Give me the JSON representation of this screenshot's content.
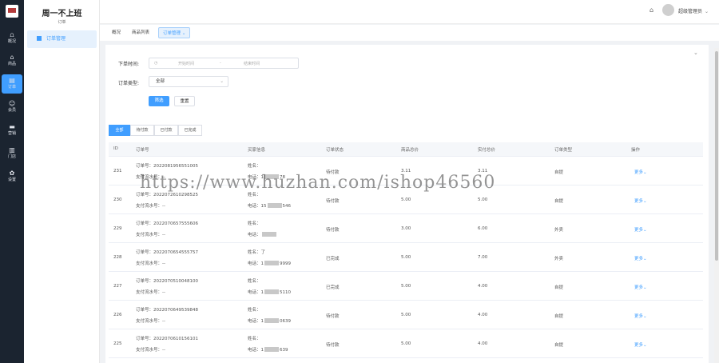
{
  "rail": [
    {
      "icon": "⩍",
      "label": "概况"
    },
    {
      "icon": "⌂",
      "label": "商品"
    },
    {
      "icon": "▤",
      "label": "订单"
    },
    {
      "icon": "☺",
      "label": "会员"
    },
    {
      "icon": "▬",
      "label": "营销"
    },
    {
      "icon": "▥",
      "label": "门店"
    },
    {
      "icon": "✿",
      "label": "设置"
    }
  ],
  "side": {
    "shop_name": "周一不上班",
    "section": "订单",
    "item": "订单管理"
  },
  "user": {
    "name": "超级管理员"
  },
  "tabs": [
    "概况",
    "商品列表",
    "订单管理"
  ],
  "filters": {
    "time_label": "下单时间:",
    "start_placeholder": "开始时间",
    "range_sep": "-",
    "end_placeholder": "结束时间",
    "type_label": "订单类型:",
    "type_value": "全部",
    "query_label": "筛选",
    "reset_label": "重置"
  },
  "status_tabs": [
    "全部",
    "待付款",
    "已付款",
    "已完成"
  ],
  "columns": [
    "ID",
    "订单号",
    "买家信息",
    "订单状态",
    "商品总价",
    "实付总价",
    "订单类型",
    "操作"
  ],
  "labels": {
    "order_no": "订单号：",
    "pay_no": "支付流水号：",
    "name": "姓名：",
    "phone": "电话：",
    "more": "更多"
  },
  "rows": [
    {
      "id": "231",
      "order": "2022081956551005",
      "pay": "--",
      "name": "",
      "phone_a": "1",
      "phone_b": "78",
      "status": "待付款",
      "goods": "3.11",
      "paid": "3.11",
      "type": "自提"
    },
    {
      "id": "230",
      "order": "2022072610298525",
      "pay": "--",
      "name": "",
      "phone_a": "15",
      "phone_b": "546",
      "status": "待付款",
      "goods": "5.00",
      "paid": "5.00",
      "type": "自提"
    },
    {
      "id": "229",
      "order": "2022070657555606",
      "pay": "--",
      "name": "",
      "phone_a": "",
      "phone_b": "",
      "status": "待付款",
      "goods": "3.00",
      "paid": "6.00",
      "type": "外卖"
    },
    {
      "id": "228",
      "order": "2022070654555757",
      "pay": "--",
      "name": "了",
      "phone_a": "1",
      "phone_b": "9999",
      "status": "已完成",
      "goods": "5.00",
      "paid": "7.00",
      "type": "外卖"
    },
    {
      "id": "227",
      "order": "2022070510048100",
      "pay": "--",
      "name": "",
      "phone_a": "1",
      "phone_b": "5110",
      "status": "已完成",
      "goods": "5.00",
      "paid": "4.00",
      "type": "自提"
    },
    {
      "id": "226",
      "order": "2022070649539848",
      "pay": "--",
      "name": "",
      "phone_a": "1",
      "phone_b": "0639",
      "status": "待付款",
      "goods": "5.00",
      "paid": "4.00",
      "type": "自提"
    },
    {
      "id": "225",
      "order": "2022070610156101",
      "pay": "--",
      "name": "",
      "phone_a": "1",
      "phone_b": "639",
      "status": "待付款",
      "goods": "5.00",
      "paid": "4.00",
      "type": "自提"
    }
  ],
  "watermark": "https://www.huzhan.com/ishop46560"
}
